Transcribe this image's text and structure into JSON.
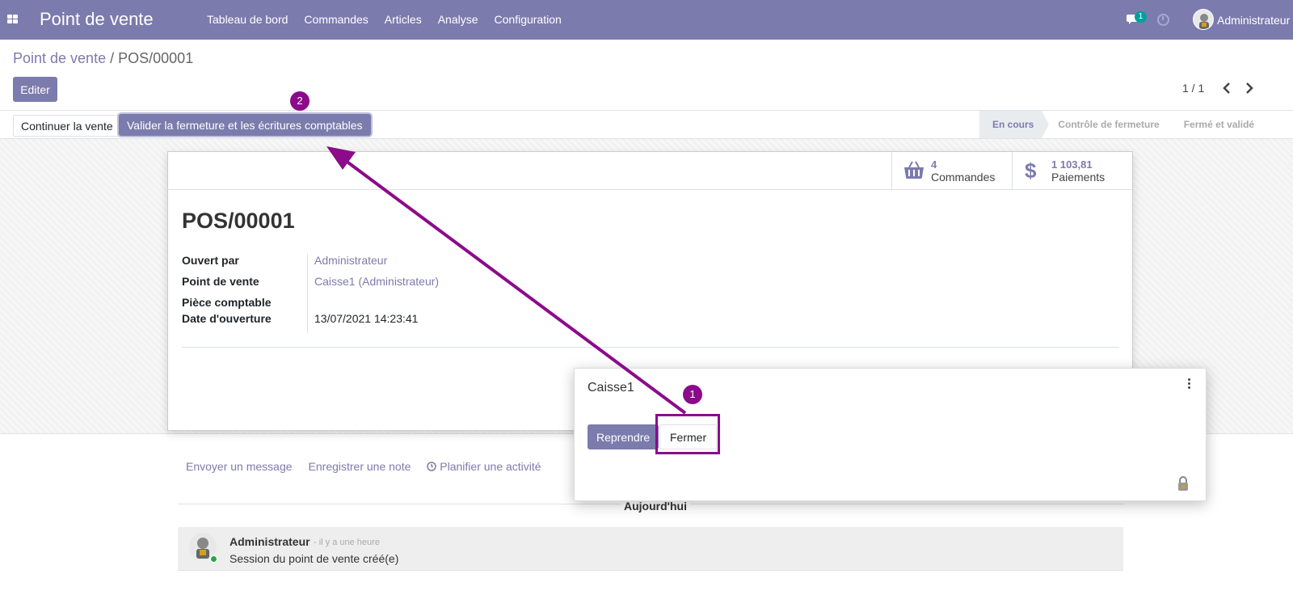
{
  "navbar": {
    "brand": "Point de vente",
    "menu": [
      "Tableau de bord",
      "Commandes",
      "Articles",
      "Analyse",
      "Configuration"
    ],
    "chat_count": "1",
    "user_name": "Administrateur"
  },
  "breadcrumb": {
    "parent": "Point de vente",
    "separator": "/",
    "current": "POS/00001"
  },
  "control": {
    "edit_label": "Editer",
    "pager": "1 / 1",
    "prev": "‹",
    "next": "›"
  },
  "statusbar": {
    "continue_label": "Continuer la vente",
    "validate_label": "Valider la fermeture et les écritures comptables",
    "stages": [
      {
        "label": "En cours",
        "active": true
      },
      {
        "label": "Contrôle de fermeture",
        "active": false
      },
      {
        "label": "Fermé et validé",
        "active": false
      }
    ]
  },
  "sheet": {
    "stats": [
      {
        "icon": "basket-icon",
        "value": "4",
        "label": "Commandes"
      },
      {
        "icon": "dollar-icon",
        "value": "1 103,81",
        "label": "Paiements"
      }
    ],
    "title": "POS/00001",
    "fields": [
      {
        "label": "Ouvert par",
        "value": "Administrateur",
        "link": true
      },
      {
        "label": "Point de vente",
        "value": "Caisse1 (Administrateur)",
        "link": true
      },
      {
        "label": "Pièce comptable",
        "value": "",
        "link": false
      },
      {
        "label": "Date d'ouverture",
        "value": "13/07/2021 14:23:41",
        "link": false
      }
    ]
  },
  "chatter": {
    "send_message": "Envoyer un message",
    "log_note": "Enregistrer une note",
    "schedule_activity": "Planifier une activité",
    "today": "Aujourd'hui",
    "message": {
      "author": "Administrateur",
      "date": "- il y a une heure",
      "body": "Session du point de vente créé(e)"
    }
  },
  "pos_card": {
    "title": "Caisse1",
    "resume_label": "Reprendre",
    "close_label": "Fermer"
  },
  "annotations": {
    "step1": "1",
    "step2": "2",
    "color": "#8b0b8b"
  },
  "colors": {
    "primary": "#7c7bad",
    "online": "#00a09d"
  }
}
